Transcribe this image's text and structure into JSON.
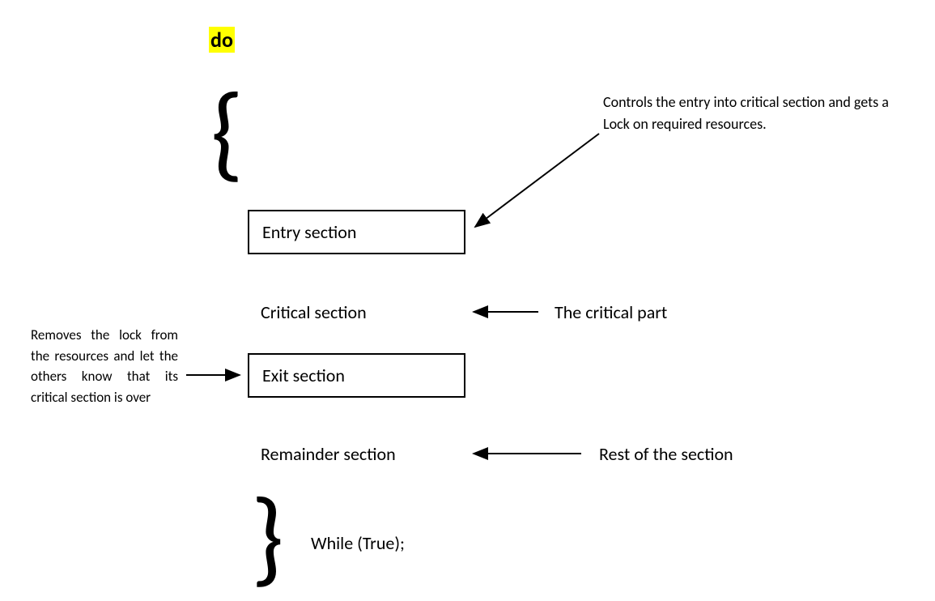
{
  "keywords": {
    "do": "do"
  },
  "sections": {
    "entry": "Entry section",
    "critical": "Critical section",
    "exit": "Exit section",
    "remainder": "Remainder section"
  },
  "while": "While (True);",
  "annotations": {
    "entry_note": "Controls the entry into critical section and gets a Lock on required resources.",
    "critical_note": "The critical part",
    "exit_note": "Removes the lock from the resources and let the others know that its critical section is over",
    "remainder_note": "Rest of the section"
  }
}
